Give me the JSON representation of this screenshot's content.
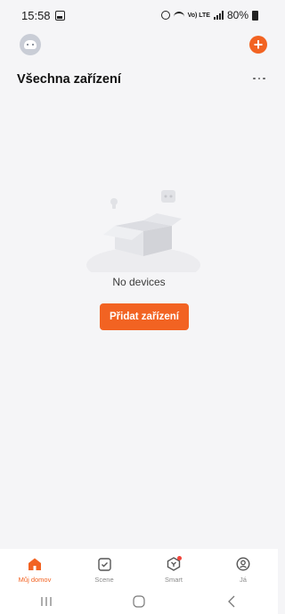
{
  "status_bar": {
    "time": "15:58",
    "network": "Vo) LTE",
    "battery": "80%"
  },
  "header": {
    "title": "Všechna zařízení"
  },
  "empty_state": {
    "message": "No devices",
    "add_button_label": "Přidat zařízení"
  },
  "bottom_nav": {
    "items": [
      {
        "label": "Můj domov",
        "icon": "home-icon",
        "active": true
      },
      {
        "label": "Scene",
        "icon": "scene-icon",
        "active": false
      },
      {
        "label": "Smart",
        "icon": "smart-icon",
        "active": false
      },
      {
        "label": "Já",
        "icon": "profile-icon",
        "active": false
      }
    ]
  },
  "colors": {
    "accent": "#f26322",
    "background": "#f5f5f7",
    "badge": "#f0433a"
  }
}
